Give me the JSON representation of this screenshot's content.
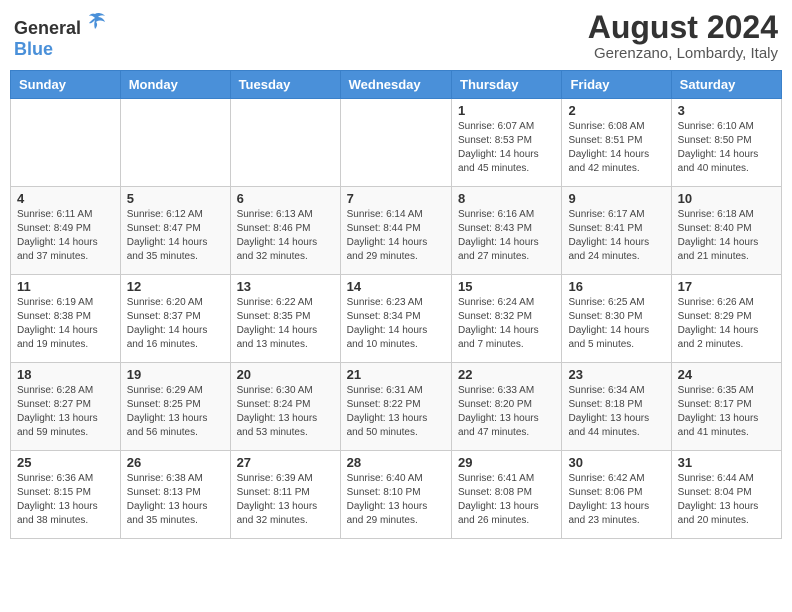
{
  "header": {
    "logo_general": "General",
    "logo_blue": "Blue",
    "month_year": "August 2024",
    "location": "Gerenzano, Lombardy, Italy"
  },
  "weekdays": [
    "Sunday",
    "Monday",
    "Tuesday",
    "Wednesday",
    "Thursday",
    "Friday",
    "Saturday"
  ],
  "weeks": [
    [
      {
        "day": "",
        "info": ""
      },
      {
        "day": "",
        "info": ""
      },
      {
        "day": "",
        "info": ""
      },
      {
        "day": "",
        "info": ""
      },
      {
        "day": "1",
        "info": "Sunrise: 6:07 AM\nSunset: 8:53 PM\nDaylight: 14 hours and 45 minutes."
      },
      {
        "day": "2",
        "info": "Sunrise: 6:08 AM\nSunset: 8:51 PM\nDaylight: 14 hours and 42 minutes."
      },
      {
        "day": "3",
        "info": "Sunrise: 6:10 AM\nSunset: 8:50 PM\nDaylight: 14 hours and 40 minutes."
      }
    ],
    [
      {
        "day": "4",
        "info": "Sunrise: 6:11 AM\nSunset: 8:49 PM\nDaylight: 14 hours and 37 minutes."
      },
      {
        "day": "5",
        "info": "Sunrise: 6:12 AM\nSunset: 8:47 PM\nDaylight: 14 hours and 35 minutes."
      },
      {
        "day": "6",
        "info": "Sunrise: 6:13 AM\nSunset: 8:46 PM\nDaylight: 14 hours and 32 minutes."
      },
      {
        "day": "7",
        "info": "Sunrise: 6:14 AM\nSunset: 8:44 PM\nDaylight: 14 hours and 29 minutes."
      },
      {
        "day": "8",
        "info": "Sunrise: 6:16 AM\nSunset: 8:43 PM\nDaylight: 14 hours and 27 minutes."
      },
      {
        "day": "9",
        "info": "Sunrise: 6:17 AM\nSunset: 8:41 PM\nDaylight: 14 hours and 24 minutes."
      },
      {
        "day": "10",
        "info": "Sunrise: 6:18 AM\nSunset: 8:40 PM\nDaylight: 14 hours and 21 minutes."
      }
    ],
    [
      {
        "day": "11",
        "info": "Sunrise: 6:19 AM\nSunset: 8:38 PM\nDaylight: 14 hours and 19 minutes."
      },
      {
        "day": "12",
        "info": "Sunrise: 6:20 AM\nSunset: 8:37 PM\nDaylight: 14 hours and 16 minutes."
      },
      {
        "day": "13",
        "info": "Sunrise: 6:22 AM\nSunset: 8:35 PM\nDaylight: 14 hours and 13 minutes."
      },
      {
        "day": "14",
        "info": "Sunrise: 6:23 AM\nSunset: 8:34 PM\nDaylight: 14 hours and 10 minutes."
      },
      {
        "day": "15",
        "info": "Sunrise: 6:24 AM\nSunset: 8:32 PM\nDaylight: 14 hours and 7 minutes."
      },
      {
        "day": "16",
        "info": "Sunrise: 6:25 AM\nSunset: 8:30 PM\nDaylight: 14 hours and 5 minutes."
      },
      {
        "day": "17",
        "info": "Sunrise: 6:26 AM\nSunset: 8:29 PM\nDaylight: 14 hours and 2 minutes."
      }
    ],
    [
      {
        "day": "18",
        "info": "Sunrise: 6:28 AM\nSunset: 8:27 PM\nDaylight: 13 hours and 59 minutes."
      },
      {
        "day": "19",
        "info": "Sunrise: 6:29 AM\nSunset: 8:25 PM\nDaylight: 13 hours and 56 minutes."
      },
      {
        "day": "20",
        "info": "Sunrise: 6:30 AM\nSunset: 8:24 PM\nDaylight: 13 hours and 53 minutes."
      },
      {
        "day": "21",
        "info": "Sunrise: 6:31 AM\nSunset: 8:22 PM\nDaylight: 13 hours and 50 minutes."
      },
      {
        "day": "22",
        "info": "Sunrise: 6:33 AM\nSunset: 8:20 PM\nDaylight: 13 hours and 47 minutes."
      },
      {
        "day": "23",
        "info": "Sunrise: 6:34 AM\nSunset: 8:18 PM\nDaylight: 13 hours and 44 minutes."
      },
      {
        "day": "24",
        "info": "Sunrise: 6:35 AM\nSunset: 8:17 PM\nDaylight: 13 hours and 41 minutes."
      }
    ],
    [
      {
        "day": "25",
        "info": "Sunrise: 6:36 AM\nSunset: 8:15 PM\nDaylight: 13 hours and 38 minutes."
      },
      {
        "day": "26",
        "info": "Sunrise: 6:38 AM\nSunset: 8:13 PM\nDaylight: 13 hours and 35 minutes."
      },
      {
        "day": "27",
        "info": "Sunrise: 6:39 AM\nSunset: 8:11 PM\nDaylight: 13 hours and 32 minutes."
      },
      {
        "day": "28",
        "info": "Sunrise: 6:40 AM\nSunset: 8:10 PM\nDaylight: 13 hours and 29 minutes."
      },
      {
        "day": "29",
        "info": "Sunrise: 6:41 AM\nSunset: 8:08 PM\nDaylight: 13 hours and 26 minutes."
      },
      {
        "day": "30",
        "info": "Sunrise: 6:42 AM\nSunset: 8:06 PM\nDaylight: 13 hours and 23 minutes."
      },
      {
        "day": "31",
        "info": "Sunrise: 6:44 AM\nSunset: 8:04 PM\nDaylight: 13 hours and 20 minutes."
      }
    ]
  ]
}
